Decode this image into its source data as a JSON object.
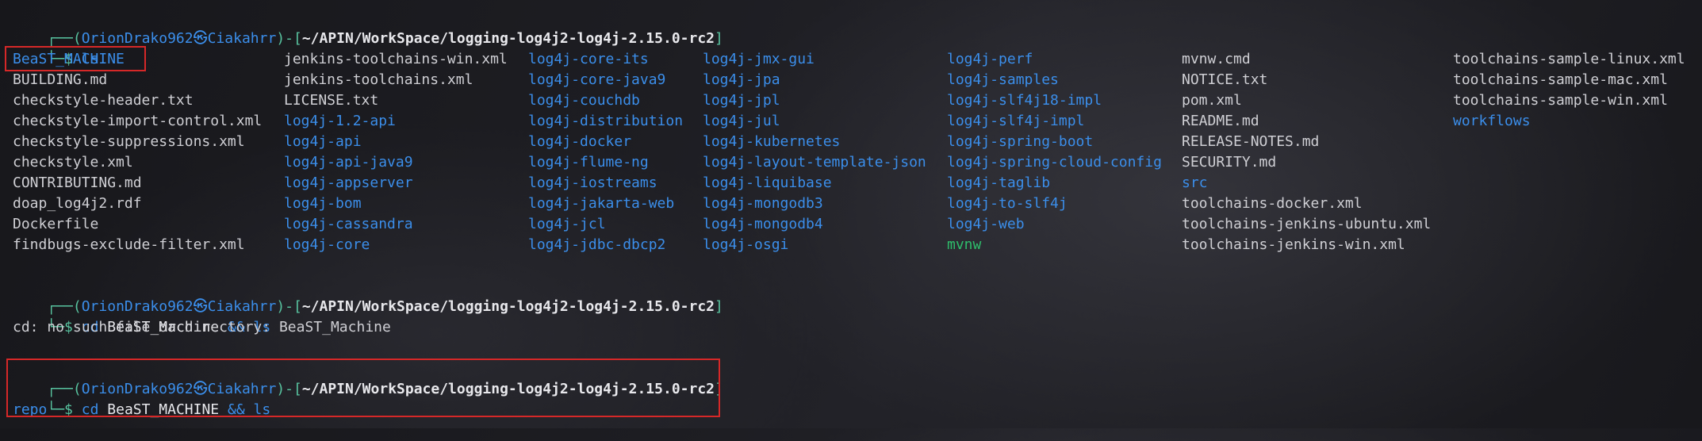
{
  "prompt": {
    "user": "OrionDrako962",
    "at": "㉿",
    "host": "Ciakahrr",
    "path": "~/APIN/WorkSpace/logging-log4j2-log4j-2.15.0-rc2",
    "symbol": "$"
  },
  "commands": [
    {
      "cmd": "ls",
      "args": "",
      "op": "",
      "tail": ""
    },
    {
      "cmd": "cd",
      "args": "BeaST_Machine",
      "op": "&&",
      "tail": "ls"
    },
    {
      "cmd": "cd",
      "args": "BeaST_MACHINE",
      "op": "&&",
      "tail": "ls"
    }
  ],
  "error_output": "cd: no such file or directory: BeaST_Machine",
  "listing_columns": [
    [
      {
        "name": "BeaST_MACHINE",
        "type": "dir"
      },
      {
        "name": "BUILDING.md",
        "type": "file"
      },
      {
        "name": "checkstyle-header.txt",
        "type": "file"
      },
      {
        "name": "checkstyle-import-control.xml",
        "type": "file"
      },
      {
        "name": "checkstyle-suppressions.xml",
        "type": "file"
      },
      {
        "name": "checkstyle.xml",
        "type": "file"
      },
      {
        "name": "CONTRIBUTING.md",
        "type": "file"
      },
      {
        "name": "doap_log4j2.rdf",
        "type": "file"
      },
      {
        "name": "Dockerfile",
        "type": "file"
      },
      {
        "name": "findbugs-exclude-filter.xml",
        "type": "file"
      }
    ],
    [
      {
        "name": "jenkins-toolchains-win.xml",
        "type": "file"
      },
      {
        "name": "jenkins-toolchains.xml",
        "type": "file"
      },
      {
        "name": "LICENSE.txt",
        "type": "file"
      },
      {
        "name": "log4j-1.2-api",
        "type": "dir"
      },
      {
        "name": "log4j-api",
        "type": "dir"
      },
      {
        "name": "log4j-api-java9",
        "type": "dir"
      },
      {
        "name": "log4j-appserver",
        "type": "dir"
      },
      {
        "name": "log4j-bom",
        "type": "dir"
      },
      {
        "name": "log4j-cassandra",
        "type": "dir"
      },
      {
        "name": "log4j-core",
        "type": "dir"
      }
    ],
    [
      {
        "name": "log4j-core-its",
        "type": "dir"
      },
      {
        "name": "log4j-core-java9",
        "type": "dir"
      },
      {
        "name": "log4j-couchdb",
        "type": "dir"
      },
      {
        "name": "log4j-distribution",
        "type": "dir"
      },
      {
        "name": "log4j-docker",
        "type": "dir"
      },
      {
        "name": "log4j-flume-ng",
        "type": "dir"
      },
      {
        "name": "log4j-iostreams",
        "type": "dir"
      },
      {
        "name": "log4j-jakarta-web",
        "type": "dir"
      },
      {
        "name": "log4j-jcl",
        "type": "dir"
      },
      {
        "name": "log4j-jdbc-dbcp2",
        "type": "dir"
      }
    ],
    [
      {
        "name": "log4j-jmx-gui",
        "type": "dir"
      },
      {
        "name": "log4j-jpa",
        "type": "dir"
      },
      {
        "name": "log4j-jpl",
        "type": "dir"
      },
      {
        "name": "log4j-jul",
        "type": "dir"
      },
      {
        "name": "log4j-kubernetes",
        "type": "dir"
      },
      {
        "name": "log4j-layout-template-json",
        "type": "dir"
      },
      {
        "name": "log4j-liquibase",
        "type": "dir"
      },
      {
        "name": "log4j-mongodb3",
        "type": "dir"
      },
      {
        "name": "log4j-mongodb4",
        "type": "dir"
      },
      {
        "name": "log4j-osgi",
        "type": "dir"
      }
    ],
    [
      {
        "name": "log4j-perf",
        "type": "dir"
      },
      {
        "name": "log4j-samples",
        "type": "dir"
      },
      {
        "name": "log4j-slf4j18-impl",
        "type": "dir"
      },
      {
        "name": "log4j-slf4j-impl",
        "type": "dir"
      },
      {
        "name": "log4j-spring-boot",
        "type": "dir"
      },
      {
        "name": "log4j-spring-cloud-config",
        "type": "dir"
      },
      {
        "name": "log4j-taglib",
        "type": "dir"
      },
      {
        "name": "log4j-to-slf4j",
        "type": "dir"
      },
      {
        "name": "log4j-web",
        "type": "dir"
      },
      {
        "name": "mvnw",
        "type": "exec"
      }
    ],
    [
      {
        "name": "mvnw.cmd",
        "type": "file"
      },
      {
        "name": "NOTICE.txt",
        "type": "file"
      },
      {
        "name": "pom.xml",
        "type": "file"
      },
      {
        "name": "README.md",
        "type": "file"
      },
      {
        "name": "RELEASE-NOTES.md",
        "type": "file"
      },
      {
        "name": "SECURITY.md",
        "type": "file"
      },
      {
        "name": "src",
        "type": "dir"
      },
      {
        "name": "toolchains-docker.xml",
        "type": "file"
      },
      {
        "name": "toolchains-jenkins-ubuntu.xml",
        "type": "file"
      },
      {
        "name": "toolchains-jenkins-win.xml",
        "type": "file"
      }
    ],
    [
      {
        "name": "toolchains-sample-linux.xml",
        "type": "file"
      },
      {
        "name": "toolchains-sample-mac.xml",
        "type": "file"
      },
      {
        "name": "toolchains-sample-win.xml",
        "type": "file"
      },
      {
        "name": "workflows",
        "type": "dir"
      }
    ]
  ],
  "final_output": [
    {
      "name": "repo",
      "type": "dir"
    }
  ],
  "colors": {
    "highlight": "#d62828",
    "directory": "#3b8eea",
    "executable": "#2ebd6b",
    "prompt_frame": "#58c4a0"
  }
}
